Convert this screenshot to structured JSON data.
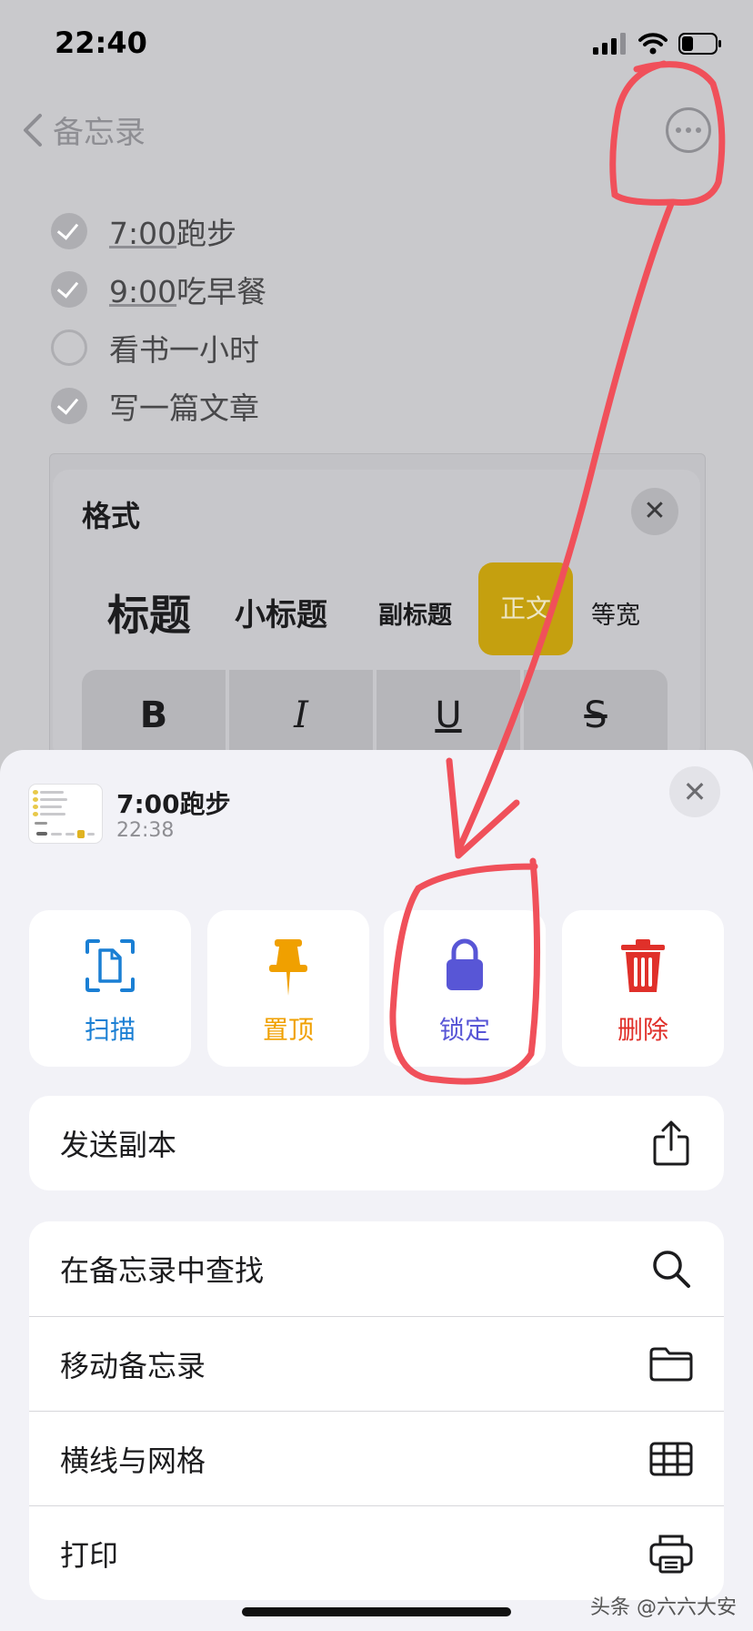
{
  "status_bar": {
    "time": "22:40"
  },
  "nav": {
    "back_label": "备忘录",
    "back_icon": "chevron-left-icon",
    "more_icon": "ellipsis-circle-icon"
  },
  "checklist": [
    {
      "text": "7:00跑步",
      "checked": true
    },
    {
      "text": "9:00吃早餐",
      "checked": true
    },
    {
      "text": "看书一小时",
      "checked": false
    },
    {
      "text": "写一篇文章",
      "checked": true
    }
  ],
  "format_panel": {
    "title": "格式",
    "styles": [
      "标题",
      "小标题",
      "副标题",
      "正文",
      "等宽"
    ],
    "selected_style": "正文",
    "buttons": [
      "B",
      "I",
      "U",
      "S"
    ]
  },
  "sheet": {
    "note_title": "7:00跑步",
    "note_time": "22:38",
    "actions": [
      {
        "label": "扫描",
        "icon": "scan-document-icon",
        "color": "#1a7fd4"
      },
      {
        "label": "置顶",
        "icon": "pin-icon",
        "color": "#f0a000"
      },
      {
        "label": "锁定",
        "icon": "lock-icon",
        "color": "#5856d6"
      },
      {
        "label": "删除",
        "icon": "trash-icon",
        "color": "#e0302a"
      }
    ],
    "menu_send": {
      "label": "发送副本",
      "icon": "share-icon"
    },
    "menu_items": [
      {
        "label": "在备忘录中查找",
        "icon": "search-icon"
      },
      {
        "label": "移动备忘录",
        "icon": "folder-icon"
      },
      {
        "label": "横线与网格",
        "icon": "grid-icon"
      },
      {
        "label": "打印",
        "icon": "printer-icon"
      }
    ]
  },
  "watermark": "头条 @六六大安",
  "colors": {
    "accent_gold": "#c5a00f",
    "annotation_red": "#f0505a",
    "sheet_bg": "#f2f2f7"
  }
}
